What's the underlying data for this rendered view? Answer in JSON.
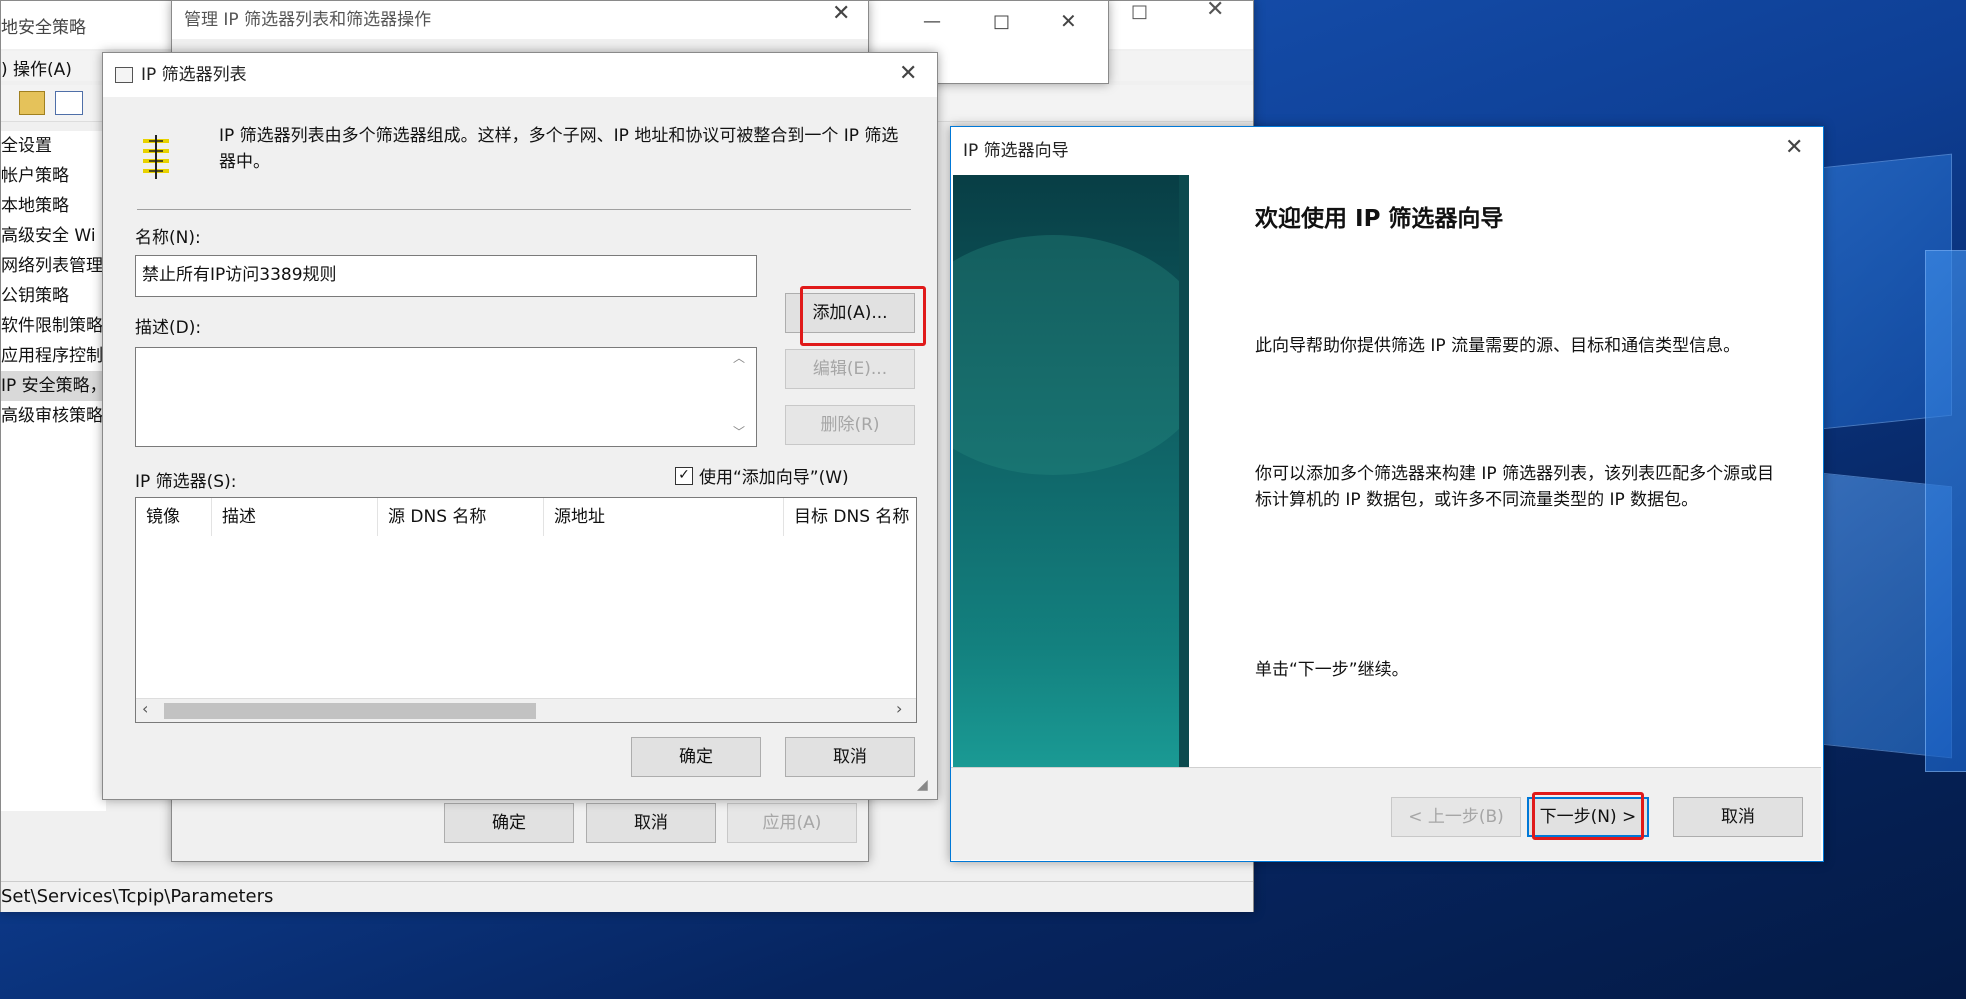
{
  "mmc": {
    "title": "地安全策略",
    "menu": ")  操作(A)",
    "tree": [
      "全设置",
      "帐户策略",
      "本地策略",
      "高级安全 Wi",
      "网络列表管理",
      "公钥策略",
      "软件限制策略",
      "应用程序控制",
      "IP 安全策略，",
      "高级审核策略"
    ],
    "statusbar": "Set\\Services\\Tcpip\\Parameters"
  },
  "manage_dialog": {
    "title": "管理 IP 筛选器列表和筛选器操作",
    "ok": "确定",
    "cancel": "取消",
    "apply": "应用(A)"
  },
  "ip_filter_list": {
    "title": "IP 筛选器列表",
    "intro": "IP 筛选器列表由多个筛选器组成。这样，多个子网、IP 地址和协议可被整合到一个 IP 筛选器中。",
    "name_label": "名称(N):",
    "name_value": "禁止所有IP访问3389规则",
    "desc_label": "描述(D):",
    "desc_value": "",
    "add_button": "添加(A)...",
    "edit_button": "编辑(E)...",
    "delete_button": "删除(R)",
    "filters_label": "IP 筛选器(S):",
    "use_wizard_label": "使用“添加向导”(W)",
    "use_wizard_checked": true,
    "columns": [
      "镜像",
      "描述",
      "源 DNS 名称",
      "源地址",
      "目标 DNS 名称"
    ],
    "ok": "确定",
    "cancel": "取消"
  },
  "wizard": {
    "title": "IP 筛选器向导",
    "heading": "欢迎使用 IP 筛选器向导",
    "para1": "此向导帮助你提供筛选 IP 流量需要的源、目标和通信类型信息。",
    "para2": "你可以添加多个筛选器来构建 IP 筛选器列表，该列表匹配多个源或目标计算机的 IP 数据包，或许多不同流量类型的 IP 数据包。",
    "para3": "单击“下一步”继续。",
    "back": "< 上一步(B)",
    "next": "下一步(N) >",
    "cancel": "取消"
  },
  "colors": {
    "highlight": "#e01a1a",
    "focus": "#0078d7",
    "wizard_banner": "#0f5f63"
  }
}
